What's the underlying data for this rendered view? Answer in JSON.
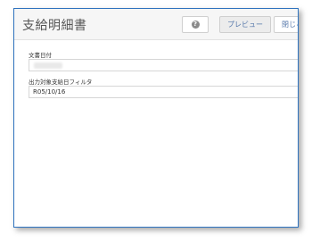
{
  "dialog": {
    "title": "支給明細書",
    "help_icon": "question-circle-icon",
    "help_glyph": "?",
    "preview_label": "プレビュー",
    "close_label": "閉じる"
  },
  "form": {
    "date_label": "文書日付",
    "date_value": "",
    "filter_label": "出力対象支給日フィルタ",
    "filter_value": "R05/10/16"
  },
  "colors": {
    "border": "#2f73bf",
    "header_bg": "#f6f6f6",
    "button_text": "#5577aa"
  }
}
